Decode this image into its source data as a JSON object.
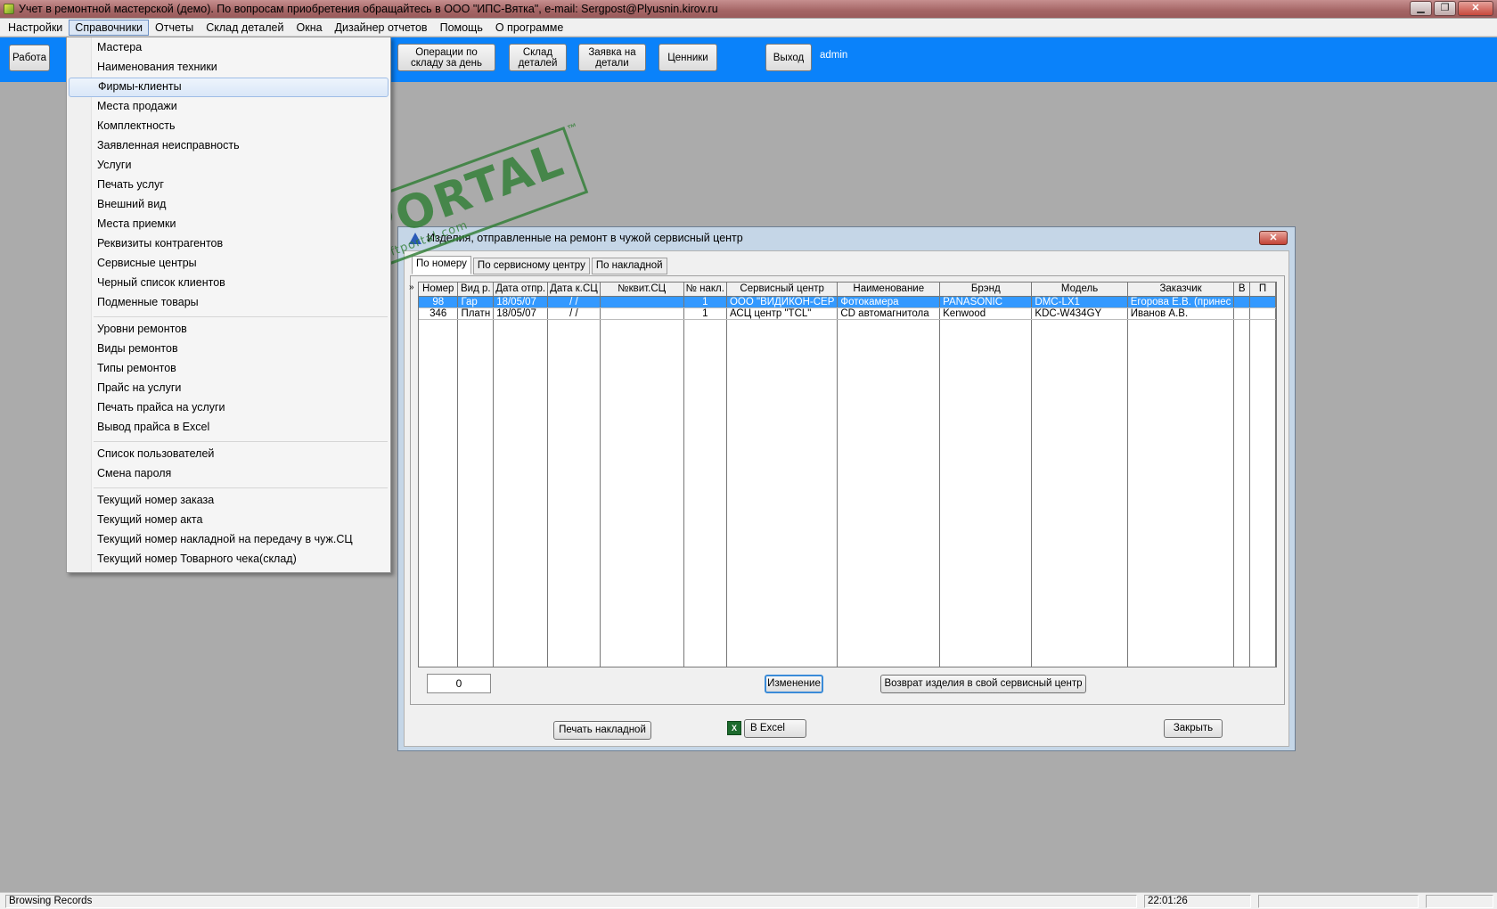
{
  "window": {
    "title": "Учет в ремонтной мастерской (демо). По вопросам приобретения обращайтесь в ООО \"ИПС-Вятка\", e-mail: Sergpost@Plyusnin.kirov.ru",
    "minimize": "▁",
    "maximize": "❐",
    "close": "✕"
  },
  "menubar": {
    "items": [
      "Настройки",
      "Справочники",
      "Отчеты",
      "Склад деталей",
      "Окна",
      "Дизайнер отчетов",
      "Помощь",
      "О программе"
    ],
    "open_item": "Справочники"
  },
  "toolbar": {
    "work": "Работа",
    "ops_day": "Операции по складу за день",
    "warehouse": "Склад деталей",
    "order_parts": "Заявка на детали",
    "price_tags": "Ценники",
    "exit": "Выход",
    "user": "admin"
  },
  "dropdown": {
    "items": [
      "Мастера",
      "Наименования техники",
      "Фирмы-клиенты",
      "Места продажи",
      "Комплектность",
      "Заявленная неисправность",
      "Услуги",
      "Печать услуг",
      "Внешний вид",
      "Места приемки",
      "Реквизиты контрагентов",
      "Сервисные центры",
      "Черный список клиентов",
      "Подменные товары",
      "Уровни ремонтов",
      "Виды ремонтов",
      "Типы ремонтов",
      "Прайс на услуги",
      "Печать прайса на услуги",
      "Вывод прайса в Excel",
      "Список пользователей",
      "Смена пароля",
      "Текущий номер заказа",
      "Текущий номер акта",
      "Текущий номер накладной на передачу в чуж.СЦ",
      "Текущий номер Товарного чека(склад)"
    ],
    "highlighted": "Фирмы-клиенты"
  },
  "watermark": {
    "main": "SOFTPORTAL",
    "sub": "www.softportal.com",
    "tm": "™"
  },
  "dialog": {
    "title": "Изделия, отправленные на ремонт в чужой сервисный центр",
    "close": "✕",
    "tabs": [
      "По номеру",
      "По сервисному центру",
      "По накладной"
    ],
    "active_tab": "По номеру",
    "row_indicator": "»",
    "columns": [
      "Номер",
      "Вид р.",
      "Дата отпр.",
      "Дата к.СЦ",
      "№квит.СЦ",
      "№ накл.",
      "Сервисный центр",
      "Наименование",
      "Брэнд",
      "Модель",
      "Заказчик",
      "В",
      "П"
    ],
    "rows": [
      [
        "98",
        "Гар",
        "18/05/07",
        "  /  /",
        "",
        "1",
        "ООО \"ВИДИКОН-СЕР",
        "Фотокамера",
        "PANASONIC",
        "DMC-LX1",
        "Егорова Е.В. (принес",
        "",
        ""
      ],
      [
        "346",
        "Платн",
        "18/05/07",
        "  /  /",
        "",
        "1",
        "АСЦ центр \"TCL\"",
        "CD автомагнитола",
        "Kenwood",
        "KDC-W434GY",
        "Иванов А.В.",
        "",
        ""
      ]
    ],
    "counter_value": "0",
    "btn_edit": "Изменение",
    "btn_return": "Возврат изделия в свой сервисный центр",
    "btn_print": "Печать накладной",
    "btn_excel": "В Excel",
    "btn_close": "Закрыть"
  },
  "statusbar": {
    "left": "Browsing Records",
    "time": "22:01:26"
  }
}
